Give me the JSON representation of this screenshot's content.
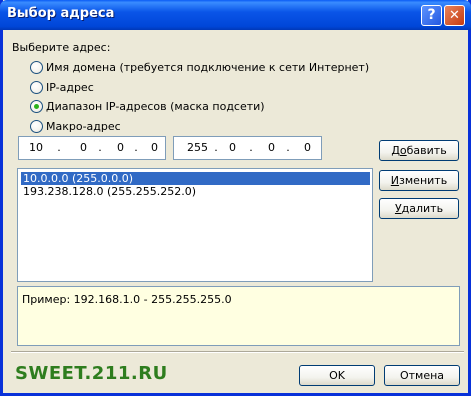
{
  "window": {
    "title": "Выбор адреса",
    "help_button": "?",
    "close_button": "✕"
  },
  "prompt_label": "Выберите адрес:",
  "radios": [
    {
      "label": "Имя домена (требуется подключение к сети Интернет)",
      "selected": false
    },
    {
      "label": "IP-адрес",
      "selected": false
    },
    {
      "label": "Диапазон IP-адресов (маска подсети)",
      "selected": true
    },
    {
      "label": "Макро-адрес",
      "selected": false
    }
  ],
  "ip_address": {
    "o1": "10",
    "o2": "0",
    "o3": "0",
    "o4": "0",
    "sep": "."
  },
  "subnet_mask": {
    "o1": "255",
    "o2": "0",
    "o3": "0",
    "o4": "0",
    "sep": "."
  },
  "buttons": {
    "add": {
      "pre": "Д",
      "mnemonic": "о",
      "post": "бавить"
    },
    "change": {
      "pre": "",
      "mnemonic": "И",
      "post": "зменить"
    },
    "delete": {
      "pre": "",
      "mnemonic": "У",
      "post": "далить"
    },
    "ok": "OK",
    "cancel": "Отмена"
  },
  "list_items": [
    {
      "text": "10.0.0.0 (255.0.0.0)",
      "selected": true
    },
    {
      "text": "193.238.128.0 (255.255.252.0)",
      "selected": false
    }
  ],
  "example_text": "Пример: 192.168.1.0 - 255.255.255.0",
  "watermark": "SWEET.211.RU",
  "colors": {
    "titlebar": "#0046d8",
    "window_bg": "#ece9d8",
    "selection": "#316ac5",
    "example_bg": "#ffffe1",
    "watermark": "#2e7d1e"
  }
}
